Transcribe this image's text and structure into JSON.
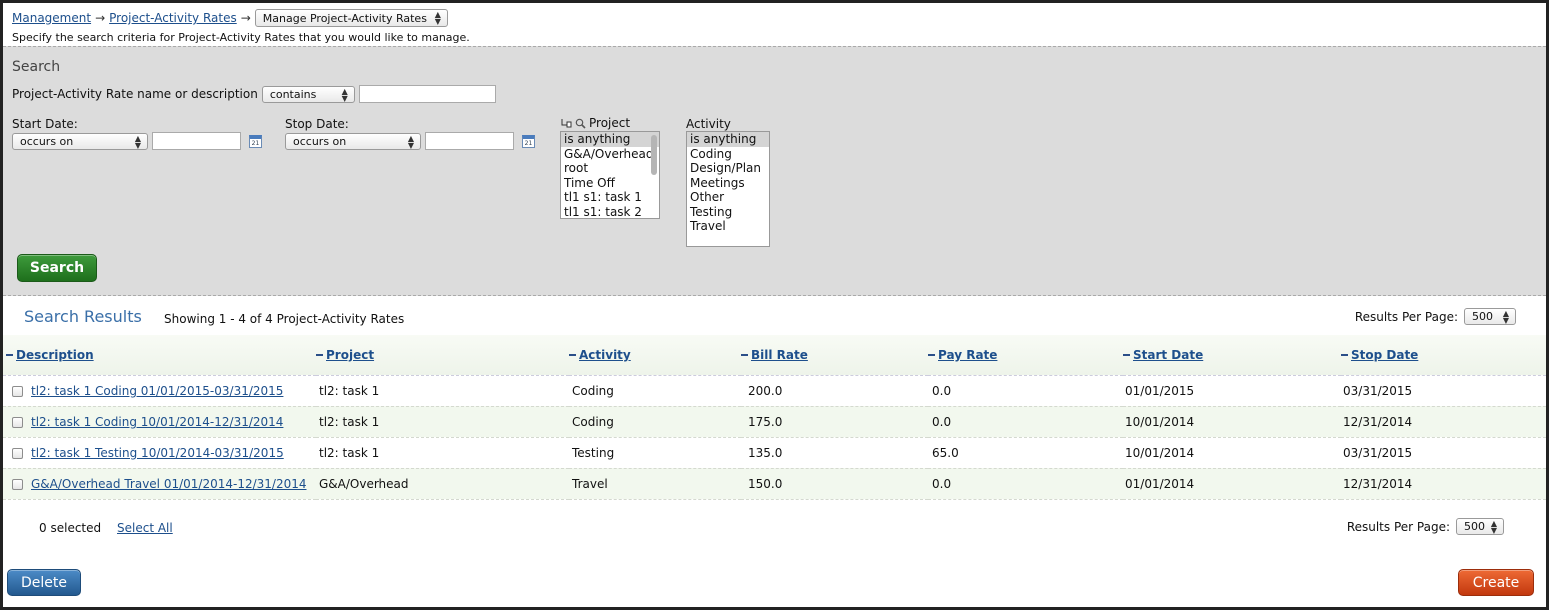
{
  "breadcrumb": {
    "items": [
      "Management",
      "Project-Activity Rates"
    ],
    "separator": "→",
    "current": "Manage Project-Activity Rates"
  },
  "hint": "Specify the search criteria for Project-Activity Rates that you would like to manage.",
  "search": {
    "title": "Search",
    "name_label": "Project-Activity Rate name or description",
    "name_operator": "contains",
    "name_value": "",
    "start_label": "Start Date:",
    "start_operator": "occurs on",
    "start_value": "",
    "stop_label": "Stop Date:",
    "stop_operator": "occurs on",
    "stop_value": "",
    "project_label": "Project",
    "project_options": [
      "is anything",
      "G&A/Overhead",
      "root",
      "Time Off",
      "tl1 s1: task 1",
      "tl1 s1: task 2"
    ],
    "activity_label": "Activity",
    "activity_options": [
      "is anything",
      "Coding",
      "Design/Plan",
      "Meetings",
      "Other",
      "Testing",
      "Travel"
    ],
    "button_label": "Search"
  },
  "results": {
    "title": "Search Results",
    "showing": "Showing 1 - 4 of 4 Project-Activity Rates",
    "rpp_label": "Results Per Page:",
    "rpp_value": "500",
    "columns": [
      "Description",
      "Project",
      "Activity",
      "Bill Rate",
      "Pay Rate",
      "Start Date",
      "Stop Date"
    ],
    "rows": [
      {
        "description": "tl2: task 1 Coding 01/01/2015-03/31/2015",
        "project": "tl2: task 1",
        "activity": "Coding",
        "bill": "200.0",
        "pay": "0.0",
        "start": "01/01/2015",
        "stop": "03/31/2015"
      },
      {
        "description": "tl2: task 1 Coding 10/01/2014-12/31/2014",
        "project": "tl2: task 1",
        "activity": "Coding",
        "bill": "175.0",
        "pay": "0.0",
        "start": "10/01/2014",
        "stop": "12/31/2014"
      },
      {
        "description": "tl2: task 1 Testing 10/01/2014-03/31/2015",
        "project": "tl2: task 1",
        "activity": "Testing",
        "bill": "135.0",
        "pay": "65.0",
        "start": "10/01/2014",
        "stop": "03/31/2015"
      },
      {
        "description": "G&A/Overhead Travel 01/01/2014-12/31/2014",
        "project": "G&A/Overhead",
        "activity": "Travel",
        "bill": "150.0",
        "pay": "0.0",
        "start": "01/01/2014",
        "stop": "12/31/2014"
      }
    ],
    "selected_count": "0",
    "selected_label": "selected",
    "select_all": "Select All"
  },
  "actions": {
    "delete_label": "Delete",
    "create_label": "Create"
  },
  "colors": {
    "search_button": "#2a852a",
    "delete_button": "#2f6da9",
    "create_button": "#dc4f1f",
    "link": "#1d4f8c"
  }
}
